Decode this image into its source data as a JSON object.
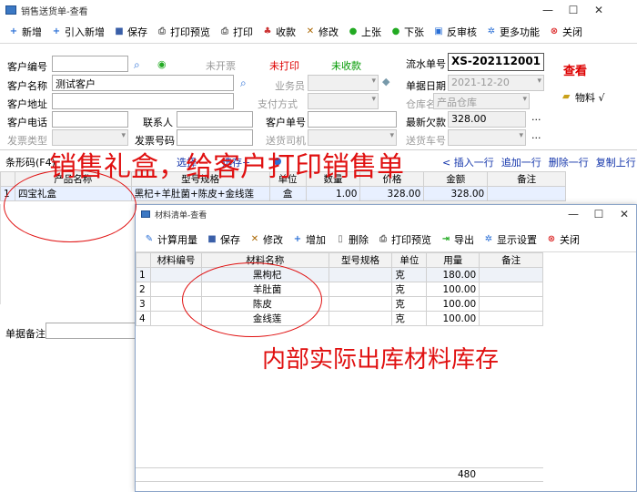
{
  "main_window": {
    "title": "销售送货单-查看",
    "toolbar": [
      {
        "label": "新增",
        "icon": "plus-icon",
        "color": "#2a6fd6",
        "glyph": "+"
      },
      {
        "label": "引入新增",
        "icon": "import-plus-icon",
        "color": "#2a6fd6",
        "glyph": "+"
      },
      {
        "label": "保存",
        "icon": "save-icon",
        "color": "#3a5fa8",
        "glyph": "■"
      },
      {
        "label": "打印预览",
        "icon": "print-preview-icon",
        "color": "#666",
        "glyph": "⎙"
      },
      {
        "label": "打印",
        "icon": "print-icon",
        "color": "#666",
        "glyph": "⎙"
      },
      {
        "label": "收款",
        "icon": "receipt-icon",
        "color": "#c33",
        "glyph": "♣"
      },
      {
        "label": "修改",
        "icon": "edit-icon",
        "color": "#a60",
        "glyph": "✕"
      },
      {
        "label": "上张",
        "icon": "prev-record-icon",
        "color": "#2a2",
        "glyph": "●"
      },
      {
        "label": "下张",
        "icon": "next-record-icon",
        "color": "#2a2",
        "glyph": "●"
      },
      {
        "label": "反审核",
        "icon": "unapprove-icon",
        "color": "#2a6fd6",
        "glyph": "▣"
      },
      {
        "label": "更多功能",
        "icon": "more-gear-icon",
        "color": "#2a6fd6",
        "glyph": "✲"
      },
      {
        "label": "关闭",
        "icon": "close-icon",
        "color": "#d33",
        "glyph": "⊗"
      }
    ],
    "form": {
      "customer_code_label": "客户编号",
      "customer_code": "",
      "status_invoice": "未开票",
      "status_print": "未打印",
      "status_payment": "未收款",
      "serial_label": "流水单号",
      "serial_no": "XS-202112001",
      "view_tag": "查看",
      "customer_name_label": "客户名称",
      "customer_name": "测试客户",
      "salesman_label": "业务员",
      "salesman": "",
      "doc_date_label": "单据日期",
      "doc_date": "2021-12-20",
      "materials_label": "物料 √",
      "customer_addr_label": "客户地址",
      "customer_addr": "",
      "payment_label": "支付方式",
      "payment": "",
      "warehouse_label": "仓库名称",
      "warehouse": "产品仓库",
      "customer_phone_label": "客户电话",
      "customer_phone": "",
      "contact_label": "联系人",
      "contact": "",
      "customer_doc_label": "客户单号",
      "customer_doc": "",
      "latest_debt_label": "最新欠款",
      "latest_debt": "328.00",
      "invoice_type_label": "发票类型",
      "invoice_type": "",
      "invoice_no_label": "发票号码",
      "invoice_no": "",
      "driver_label": "送货司机",
      "driver": "",
      "car_label": "送货车号",
      "car": ""
    },
    "barcode_label": "条形码(F4)",
    "select_link": "选择",
    "actions": [
      "< 插入一行",
      "追加一行",
      "删除一行",
      "复制上行"
    ],
    "grid": {
      "columns": [
        "产品名称",
        "型号规格",
        "单位",
        "数量",
        "价格",
        "金额",
        "备注"
      ],
      "rows": [
        {
          "no": "1",
          "name": "四宝礼盒",
          "spec": "黑杞+羊肚菌+陈皮+金线莲",
          "unit": "盒",
          "qty": "1.00",
          "price": "328.00",
          "amount": "328.00",
          "note": ""
        }
      ]
    },
    "remark_label": "单据备注",
    "remark": ""
  },
  "material_window": {
    "title": "材料清单-查看",
    "toolbar": [
      {
        "label": "计算用量",
        "icon": "calculate-icon",
        "color": "#2a6fd6",
        "glyph": "✎"
      },
      {
        "label": "保存",
        "icon": "save-icon",
        "color": "#3a5fa8",
        "glyph": "■"
      },
      {
        "label": "修改",
        "icon": "edit-icon",
        "color": "#a60",
        "glyph": "✕"
      },
      {
        "label": "增加",
        "icon": "plus-icon",
        "color": "#2a6fd6",
        "glyph": "+"
      },
      {
        "label": "删除",
        "icon": "trash-icon",
        "color": "#666",
        "glyph": "▯"
      },
      {
        "label": "打印预览",
        "icon": "print-preview-icon",
        "color": "#666",
        "glyph": "⎙"
      },
      {
        "label": "导出",
        "icon": "export-icon",
        "color": "#2a2",
        "glyph": "⇥"
      },
      {
        "label": "显示设置",
        "icon": "settings-icon",
        "color": "#2a6fd6",
        "glyph": "✲"
      },
      {
        "label": "关闭",
        "icon": "close-icon",
        "color": "#d33",
        "glyph": "⊗"
      }
    ],
    "grid": {
      "columns": [
        "材料编号",
        "材料名称",
        "型号规格",
        "单位",
        "用量",
        "备注"
      ],
      "rows": [
        {
          "no": "1",
          "code": "",
          "name": "黑枸杞",
          "spec": "",
          "unit": "克",
          "qty": "180.00",
          "note": ""
        },
        {
          "no": "2",
          "code": "",
          "name": "羊肚菌",
          "spec": "",
          "unit": "克",
          "qty": "100.00",
          "note": ""
        },
        {
          "no": "3",
          "code": "",
          "name": "陈皮",
          "spec": "",
          "unit": "克",
          "qty": "100.00",
          "note": ""
        },
        {
          "no": "4",
          "code": "",
          "name": "金线莲",
          "spec": "",
          "unit": "克",
          "qty": "100.00",
          "note": ""
        }
      ],
      "total_qty": "480"
    }
  },
  "annotations": {
    "top_caption": "销售礼盒，给客户打印销售单",
    "bottom_caption": "内部实际出库材料库存",
    "color": "#e01010"
  }
}
